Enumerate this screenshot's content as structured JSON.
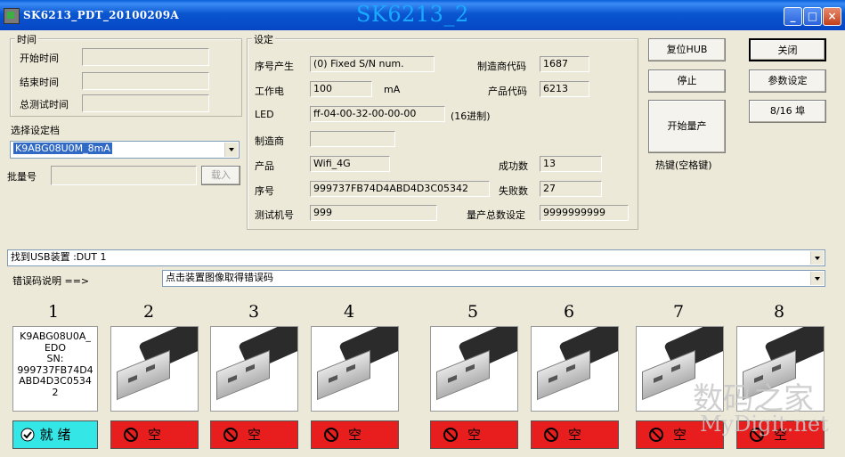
{
  "window": {
    "title": "SK6213_PDT_20100209A",
    "center_title": "SK6213_2"
  },
  "time_group": {
    "title": "时间",
    "rows": [
      {
        "label": "开始时间",
        "value": ""
      },
      {
        "label": "结束时间",
        "value": ""
      },
      {
        "label": "总测试时间",
        "value": ""
      }
    ]
  },
  "profile": {
    "label": "选择设定档",
    "selected": "K9ABG08U0M_8mA"
  },
  "batch": {
    "label": "批量号",
    "value": "",
    "load_button": "载入"
  },
  "settings": {
    "title": "设定",
    "serial_gen_label": "序号产生",
    "serial_gen_value": "(0) Fixed S/N num.",
    "vendor_code_label": "制造商代码",
    "vendor_code_value": "1687",
    "current_label": "工作电",
    "current_value": "100",
    "current_unit": "mA",
    "product_code_label": "产品代码",
    "product_code_value": "6213",
    "led_label": "LED",
    "led_value": "ff-04-00-32-00-00-00",
    "led_unit": "(16进制)",
    "manufacturer_label": "制造商",
    "manufacturer_value": "",
    "product_label": "产品",
    "product_value": "Wifi_4G",
    "success_label": "成功数",
    "success_value": "13",
    "serial_label": "序号",
    "serial_value": "999737FB74D4ABD4D3C05342",
    "fail_label": "失败数",
    "fail_value": "27",
    "tester_label": "测试机号",
    "tester_value": "999",
    "total_label": "量产总数设定",
    "total_value": "9999999999"
  },
  "buttons": {
    "reset_hub": "复位HUB",
    "close": "关闭",
    "stop": "停止",
    "params": "参数设定",
    "start": "开始量产",
    "ports": "8/16 埠",
    "hotkey": "热键(空格键)"
  },
  "usb_found": "找到USB装置 :DUT 1",
  "error_code": {
    "label": "错误码说明 ==>",
    "value": "点击装置图像取得错误码"
  },
  "ports": [
    {
      "number": "1",
      "info": "K9ABG08U0A_\nEDO\nSN:\n999737FB74D4\nABD4D3C0534\n2",
      "status": "就 绪",
      "state": "ready"
    },
    {
      "number": "2",
      "status": "空",
      "state": "empty"
    },
    {
      "number": "3",
      "status": "空",
      "state": "empty"
    },
    {
      "number": "4",
      "status": "空",
      "state": "empty"
    },
    {
      "number": "5",
      "status": "空",
      "state": "empty"
    },
    {
      "number": "6",
      "status": "空",
      "state": "empty"
    },
    {
      "number": "7",
      "status": "空",
      "state": "empty"
    },
    {
      "number": "8",
      "status": "空",
      "state": "empty"
    }
  ],
  "watermark": {
    "cn": "数码之家",
    "en": "MyDigit.net"
  },
  "colors": {
    "empty": "#e81e1e",
    "ready": "#35e6e6",
    "title_accent": "#19a9ff"
  }
}
